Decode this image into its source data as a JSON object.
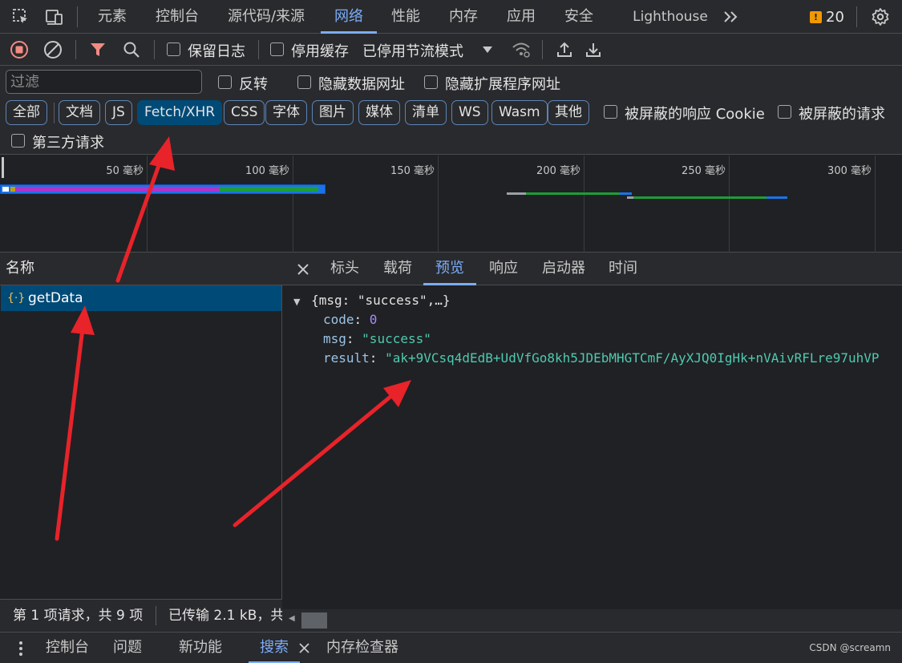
{
  "main_tabs": [
    "元素",
    "控制台",
    "源代码/来源",
    "网络",
    "性能",
    "内存",
    "应用",
    "安全",
    "Lighthouse"
  ],
  "active_main_tab": "网络",
  "issues_count": "20",
  "toolbar": {
    "preserve_log": "保留日志",
    "disable_cache": "停用缓存",
    "throttling": "已停用节流模式"
  },
  "filter": {
    "placeholder": "过滤",
    "invert": "反转",
    "hide_data_urls": "隐藏数据网址",
    "hide_extension_urls": "隐藏扩展程序网址",
    "types": [
      "全部",
      "文档",
      "JS",
      "Fetch/XHR",
      "CSS",
      "字体",
      "图片",
      "媒体",
      "清单",
      "WS",
      "Wasm",
      "其他"
    ],
    "active_type": "Fetch/XHR",
    "blocked_cookies": "被屏蔽的响应 Cookie",
    "blocked_requests": "被屏蔽的请求",
    "third_party": "第三方请求"
  },
  "timeline": {
    "labels": [
      "50 毫秒",
      "100 毫秒",
      "150 毫秒",
      "200 毫秒",
      "250 毫秒",
      "300 毫秒"
    ]
  },
  "request_list": {
    "header": "名称",
    "rows": [
      {
        "name": "getData"
      }
    ],
    "status_selected": "第 1 项请求，共 9 项",
    "status_transferred": "已传输 2.1 kB，共"
  },
  "detail_tabs": [
    "标头",
    "载荷",
    "预览",
    "响应",
    "启动器",
    "时间"
  ],
  "active_detail_tab": "预览",
  "preview": {
    "summary": "{msg: \"success\",…}",
    "code_key": "code",
    "code_value": "0",
    "msg_key": "msg",
    "msg_value": "\"success\"",
    "result_key": "result",
    "result_value": "\"ak+9VCsq4dEdB+UdVfGo8kh5JDEbMHGTCmF/AyXJQ0IgHk+nVAivRFLre97uhVP"
  },
  "drawer_tabs": [
    "控制台",
    "问题",
    "新功能",
    "搜索",
    "内存检查器"
  ],
  "active_drawer_tab": "搜索",
  "watermark": "CSDN @screamn",
  "colors": {
    "background": "#202124",
    "panel": "#292a2d",
    "accent": "#7cacf8",
    "selection": "#004a77",
    "arrow": "#e8232a"
  }
}
